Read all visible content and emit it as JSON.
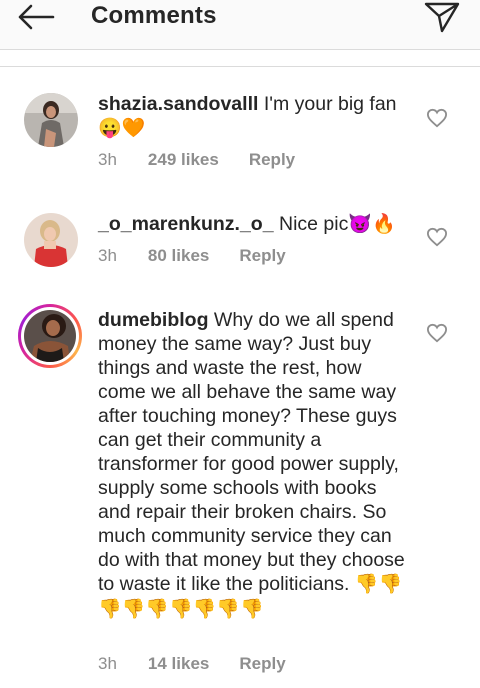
{
  "header": {
    "title": "Comments",
    "back_icon": "arrow-left-icon",
    "share_icon": "paper-plane-icon"
  },
  "comments": [
    {
      "username": "shazia.sandovalll",
      "text": " I'm your big fan ",
      "emoji": "😛🧡",
      "time": "3h",
      "likes": "249 likes",
      "reply": "Reply"
    },
    {
      "username": "_o_marenkunz._o_",
      "text": " Nice pic",
      "emoji": "😈🔥",
      "time": "3h",
      "likes": "80 likes",
      "reply": "Reply"
    },
    {
      "username": "dumebiblog",
      "text": " Why do we all spend money the same way? Just buy things and waste the rest, how come we all behave the same way after touching money? These guys can get their community  a transformer for good power supply, supply some schools with books and repair their broken chairs. So much community service they can do with that money but they choose to waste it like the politicians. ",
      "emoji": "👎👎👎👎👎👎👎👎👎",
      "time": "3h",
      "likes": "14 likes",
      "reply": "Reply"
    }
  ],
  "colors": {
    "text": "#262626",
    "muted": "#8e8e8e",
    "divider": "#dbdbdb",
    "header_bg": "#fafafa"
  }
}
